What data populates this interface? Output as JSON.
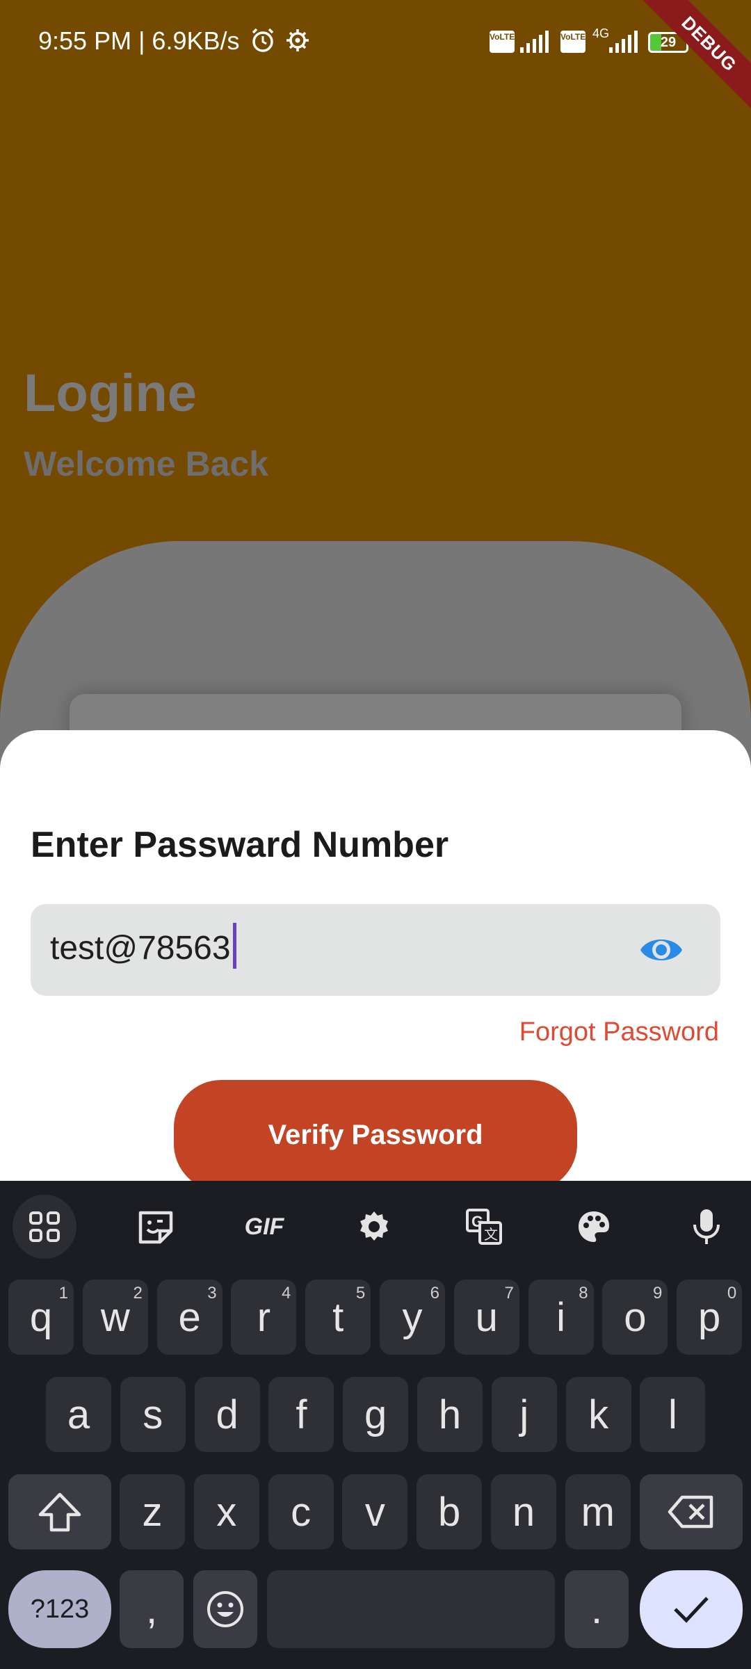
{
  "status_bar": {
    "time": "9:55 PM | 6.9KB/s",
    "sim1_badge": "VoLTE",
    "sim2_badge": "VoLTE",
    "network_type": "4G",
    "battery": "29",
    "debug_label": "DEBUG",
    "icons": [
      "alarm-icon",
      "settings-gear-icon",
      "signal-icon",
      "battery-icon"
    ]
  },
  "background": {
    "title": "Logine",
    "subtitle": "Welcome Back"
  },
  "sheet": {
    "title": "Enter Passward Number",
    "password_value": "test@78563",
    "visibility_icon": "eye-icon",
    "forgot_label": "Forgot Password",
    "verify_label": "Verify Password",
    "accent_color": "#c24424",
    "link_color": "#e04a33"
  },
  "keyboard": {
    "toolbar": {
      "gif_label": "GIF",
      "icons": [
        "apps-grid-icon",
        "sticker-icon",
        "gif-icon",
        "settings-icon",
        "translate-icon",
        "palette-icon",
        "mic-icon"
      ]
    },
    "row1": [
      {
        "k": "q",
        "h": "1"
      },
      {
        "k": "w",
        "h": "2"
      },
      {
        "k": "e",
        "h": "3"
      },
      {
        "k": "r",
        "h": "4"
      },
      {
        "k": "t",
        "h": "5"
      },
      {
        "k": "y",
        "h": "6"
      },
      {
        "k": "u",
        "h": "7"
      },
      {
        "k": "i",
        "h": "8"
      },
      {
        "k": "o",
        "h": "9"
      },
      {
        "k": "p",
        "h": "0"
      }
    ],
    "row2": [
      "a",
      "s",
      "d",
      "f",
      "g",
      "h",
      "j",
      "k",
      "l"
    ],
    "row3": [
      "z",
      "x",
      "c",
      "v",
      "b",
      "n",
      "m"
    ],
    "symbols_label": "?123",
    "comma": ",",
    "period": "."
  }
}
